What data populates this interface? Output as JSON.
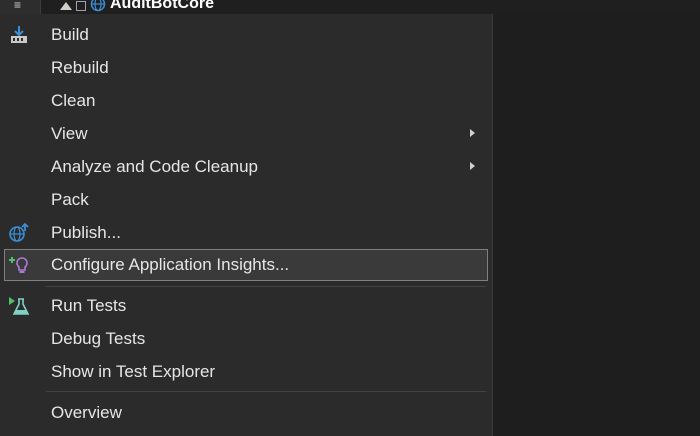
{
  "window": {
    "project_title": "AuditBotCore"
  },
  "menu": {
    "items": [
      {
        "label": "Build",
        "icon": "build-icon"
      },
      {
        "label": "Rebuild"
      },
      {
        "label": "Clean"
      },
      {
        "label": "View",
        "submenu": true
      },
      {
        "label": "Analyze and Code Cleanup",
        "submenu": true
      },
      {
        "label": "Pack"
      },
      {
        "label": "Publish...",
        "icon": "publish-globe-icon"
      },
      {
        "label": "Configure Application Insights...",
        "icon": "application-insights-icon",
        "selected": true
      },
      {
        "label": "Run Tests",
        "icon": "run-tests-flask-icon"
      },
      {
        "label": "Debug Tests"
      },
      {
        "label": "Show in Test Explorer"
      },
      {
        "label": "Overview"
      }
    ]
  },
  "colors": {
    "menu_bg": "#2b2b2b",
    "selected_bg": "#3a3a3a",
    "selected_border": "#808080",
    "text": "#e6e6e6",
    "right_pane": "#1e1e1e"
  }
}
